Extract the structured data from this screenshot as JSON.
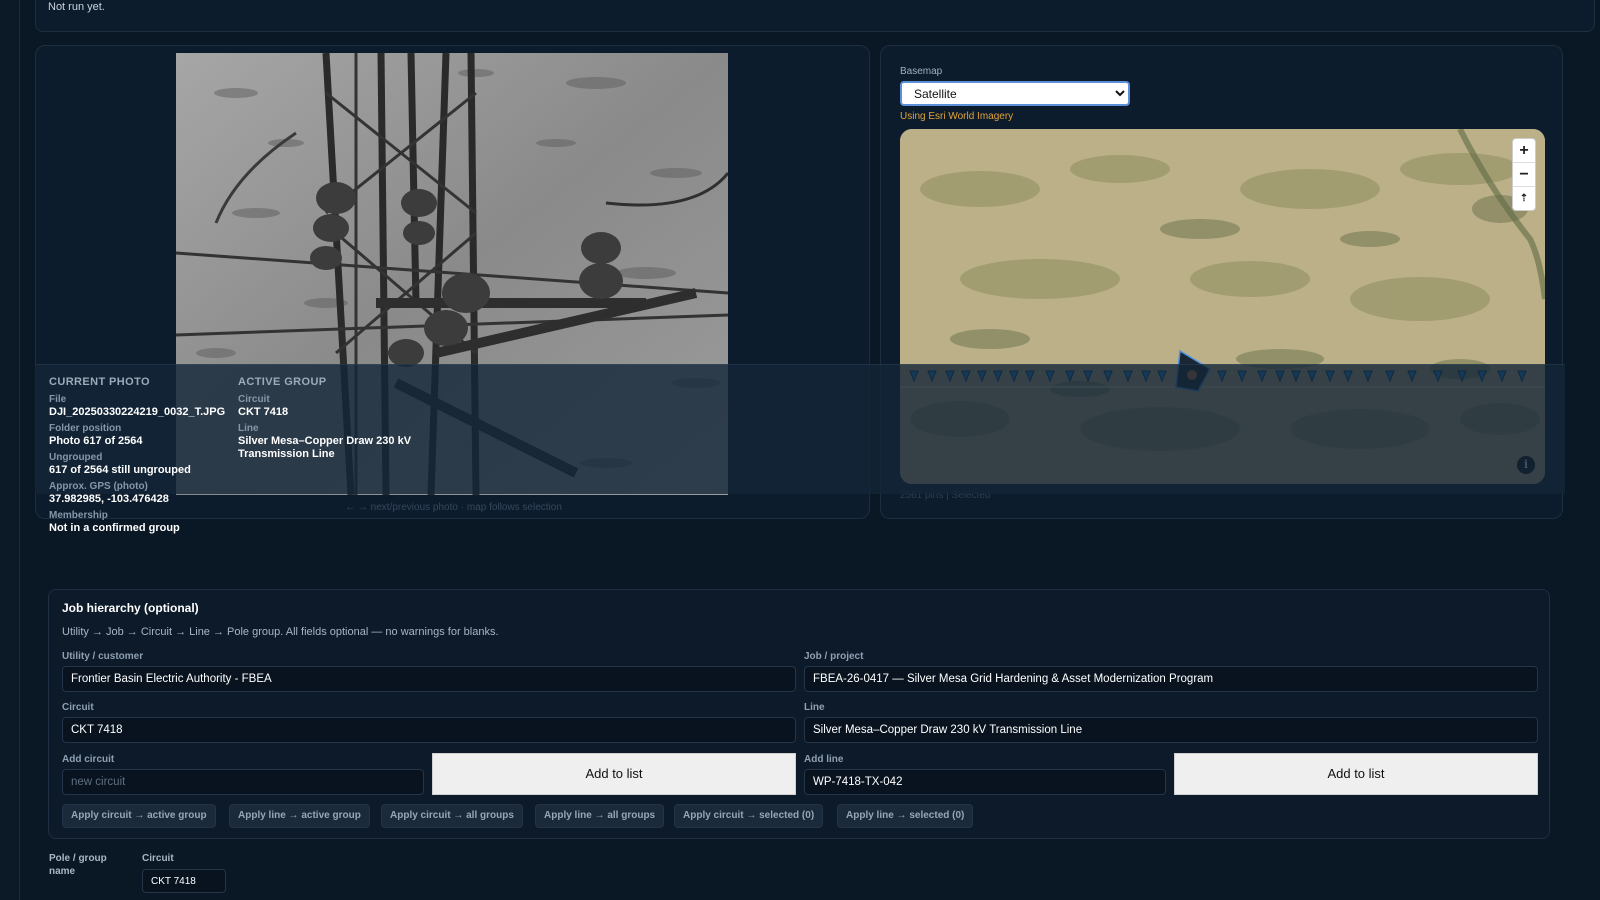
{
  "status": {
    "text": "Not run yet."
  },
  "photo_panel": {
    "hint": "← → next/previous photo · map follows selection"
  },
  "map_panel": {
    "basemap_label": "Basemap",
    "basemap_selected": "Satellite",
    "basemap_note": "Using Esri World Imagery",
    "zoom_in": "+",
    "zoom_out": "−",
    "reset_north": "⇡",
    "info": "i",
    "footer": "2561 pins | Selected"
  },
  "current_photo": {
    "heading": "CURRENT PHOTO",
    "file_label": "File",
    "file": "DJI_20250330224219_0032_T.JPG",
    "folder_label": "Folder position",
    "folder": "Photo 617 of 2564",
    "ungrouped_label": "Ungrouped",
    "ungrouped": "617 of 2564 still ungrouped",
    "gps_label": "Approx. GPS (photo)",
    "gps": "37.982985, -103.476428",
    "membership_label": "Membership",
    "membership": "Not in a confirmed group"
  },
  "active_group": {
    "heading": "ACTIVE GROUP",
    "circuit_label": "Circuit",
    "circuit": "CKT 7418",
    "line_label": "Line",
    "line": "Silver Mesa–Copper Draw 230 kV Transmission Line"
  },
  "hierarchy": {
    "title": "Job hierarchy (optional)",
    "subtitle": "Utility → Job → Circuit → Line → Pole group. All fields optional — no warnings for blanks.",
    "utility_label": "Utility / customer",
    "utility": "Frontier Basin Electric Authority - FBEA",
    "job_label": "Job / project",
    "job": "FBEA-26-0417 — Silver Mesa Grid Hardening & Asset Modernization Program",
    "circuit_label": "Circuit",
    "circuit": "CKT 7418",
    "line_label": "Line",
    "line": "Silver Mesa–Copper Draw 230 kV Transmission Line",
    "add_circuit_label": "Add circuit",
    "add_circuit_placeholder": "new circuit",
    "add_circuit_button": "Add to list",
    "add_line_label": "Add line",
    "add_line_value": "WP-7418-TX-042",
    "add_line_button": "Add to list",
    "apply_buttons": [
      "Apply circuit → active group",
      "Apply line → active group",
      "Apply circuit → all groups",
      "Apply line → all groups",
      "Apply circuit → selected (0)",
      "Apply line → selected (0)"
    ]
  },
  "pole_group": {
    "name_label": "Pole / group name",
    "circuit_label": "Circuit",
    "circuit_value": "CKT 7418"
  },
  "colors": {
    "background": "#0a1725",
    "panel": "#0d1c2c",
    "accent_note": "#e0a338",
    "pin_blue": "#1e88e5",
    "selected_pin": "#1b2633"
  },
  "icons": [
    "zoom-in-icon",
    "zoom-out-icon",
    "reset-north-icon",
    "info-icon",
    "map-pin-icon",
    "chevron-down-icon"
  ]
}
